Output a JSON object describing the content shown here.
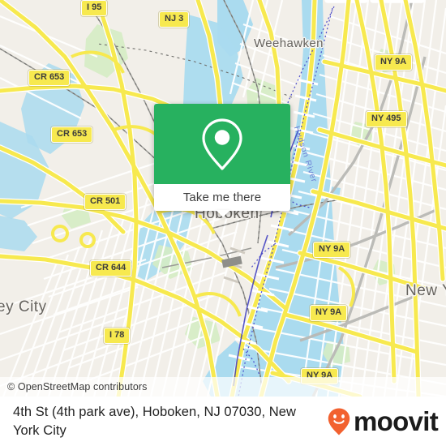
{
  "map": {
    "attribution": "© OpenStreetMap contributors",
    "water_label": "Hudson River",
    "colors": {
      "land": "#f2efe9",
      "water": "#aadbef",
      "road_major": "#f7e94f",
      "road_minor": "#ffffff",
      "park": "#d3ecc0",
      "shield_bg": "#f7e94f",
      "accent_green": "#27b15f",
      "brand_orange": "#f2612f"
    },
    "places": [
      {
        "name": "Weehawken",
        "size": "city"
      },
      {
        "name": "Hoboken",
        "size": "big"
      },
      {
        "name": "ey City",
        "size": "big"
      },
      {
        "name": "New Y",
        "size": "big"
      }
    ],
    "shields": [
      {
        "label": "I 95"
      },
      {
        "label": "NJ 3"
      },
      {
        "label": "CR 653"
      },
      {
        "label": "CR 653"
      },
      {
        "label": "NY 9A"
      },
      {
        "label": "NY 495"
      },
      {
        "label": "CR 501"
      },
      {
        "label": "CR 644"
      },
      {
        "label": "NY 9A"
      },
      {
        "label": "NY 9A"
      },
      {
        "label": "I 78"
      },
      {
        "label": "NY 9A"
      }
    ]
  },
  "popup": {
    "icon": "map-pin-icon",
    "cta_label": "Take me there"
  },
  "footer": {
    "title": "4th St (4th park ave), Hoboken, NJ 07030, New York City",
    "brand_name": "moovit",
    "brand_icon": "moovit-pin-smile-icon"
  }
}
